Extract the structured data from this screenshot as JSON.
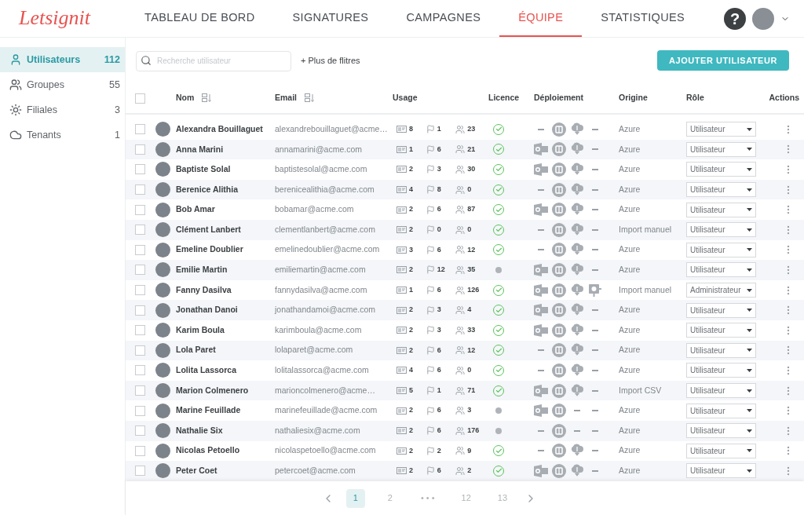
{
  "header": {
    "logo": "Letsignit",
    "nav": [
      {
        "label": "TABLEAU DE BORD",
        "selected": false
      },
      {
        "label": "SIGNATURES",
        "selected": false
      },
      {
        "label": "CAMPAGNES",
        "selected": false
      },
      {
        "label": "ÉQUIPE",
        "selected": true
      },
      {
        "label": "STATISTIQUES",
        "selected": false
      }
    ],
    "help": "?"
  },
  "sidebar": {
    "items": [
      {
        "kind": "user",
        "label": "Utilisateurs",
        "count": "112",
        "selected": true
      },
      {
        "kind": "groups",
        "label": "Groupes",
        "count": "55",
        "selected": false
      },
      {
        "kind": "branches",
        "label": "Filiales",
        "count": "3",
        "selected": false
      },
      {
        "kind": "tenants",
        "label": "Tenants",
        "count": "1",
        "selected": false
      }
    ]
  },
  "toolbar": {
    "search": {
      "placeholder": "Recherche utilisateur"
    },
    "filters": "+ Plus de flitres",
    "add_button": "AJOUTER UTILISATEUR"
  },
  "table": {
    "select_all": {
      "checked": false
    },
    "columns": [
      "Nom",
      "Email",
      "Usage",
      "Licence",
      "Déploiement",
      "Origine",
      "Rôle",
      "Actions"
    ],
    "rows": [
      {
        "name": "Alexandra Bouillaguet",
        "email": "alexandrebouillaguet@acme…",
        "usage": [
          "8",
          "1",
          "23"
        ],
        "licensed": true,
        "outlook": false,
        "office": true,
        "cloud": true,
        "addin": false,
        "origin": "Azure",
        "role": "Utilisateur",
        "checked": false
      },
      {
        "name": "Anna Marini",
        "email": "annamarini@acme.com",
        "usage": [
          "1",
          "6",
          "21"
        ],
        "licensed": true,
        "outlook": true,
        "office": true,
        "cloud": true,
        "addin": false,
        "origin": "Azure",
        "role": "Utilisateur",
        "checked": false
      },
      {
        "name": "Baptiste Solal",
        "email": "baptistesolal@acme.com",
        "usage": [
          "2",
          "3",
          "30"
        ],
        "licensed": true,
        "outlook": true,
        "office": true,
        "cloud": true,
        "addin": false,
        "origin": "Azure",
        "role": "Utilisateur",
        "checked": false
      },
      {
        "name": "Berenice Alithia",
        "email": "berenicealithia@acme.com",
        "usage": [
          "4",
          "8",
          "0"
        ],
        "licensed": true,
        "outlook": false,
        "office": true,
        "cloud": true,
        "addin": false,
        "origin": "Azure",
        "role": "Utilisateur",
        "checked": false
      },
      {
        "name": "Bob Amar",
        "email": "bobamar@acme.com",
        "usage": [
          "2",
          "6",
          "87"
        ],
        "licensed": true,
        "outlook": true,
        "office": true,
        "cloud": true,
        "addin": false,
        "origin": "Azure",
        "role": "Utilisateur",
        "checked": false
      },
      {
        "name": "Clément Lanbert",
        "email": "clementlanbert@acme.com",
        "usage": [
          "2",
          "0",
          "0"
        ],
        "licensed": true,
        "outlook": false,
        "office": true,
        "cloud": true,
        "addin": false,
        "origin": "Import manuel",
        "role": "Utilisateur",
        "checked": false
      },
      {
        "name": "Emeline Doublier",
        "email": "emelinedoublier@acme.com",
        "usage": [
          "3",
          "6",
          "12"
        ],
        "licensed": true,
        "outlook": false,
        "office": true,
        "cloud": true,
        "addin": false,
        "origin": "Azure",
        "role": "Utilisateur",
        "checked": false
      },
      {
        "name": "Emilie Martin",
        "email": "emiliemartin@acme.com",
        "usage": [
          "2",
          "12",
          "35"
        ],
        "licensed": false,
        "outlook": true,
        "office": true,
        "cloud": true,
        "addin": false,
        "origin": "Azure",
        "role": "Utilisateur",
        "checked": false
      },
      {
        "name": "Fanny Dasilva",
        "email": "fannydasilva@acme.com",
        "usage": [
          "1",
          "6",
          "126"
        ],
        "licensed": true,
        "outlook": true,
        "office": true,
        "cloud": true,
        "addin": true,
        "origin": "Import manuel",
        "role": "Administrateur",
        "checked": false
      },
      {
        "name": "Jonathan Danoi",
        "email": "jonathandamoi@acme.com",
        "usage": [
          "2",
          "3",
          "4"
        ],
        "licensed": true,
        "outlook": true,
        "office": true,
        "cloud": true,
        "addin": false,
        "origin": "Azure",
        "role": "Utilisateur",
        "checked": false
      },
      {
        "name": "Karim Boula",
        "email": "karimboula@acme.com",
        "usage": [
          "2",
          "3",
          "33"
        ],
        "licensed": true,
        "outlook": true,
        "office": true,
        "cloud": true,
        "addin": false,
        "origin": "Azure",
        "role": "Utilisateur",
        "checked": false
      },
      {
        "name": "Lola Paret",
        "email": "lolaparet@acme.com",
        "usage": [
          "2",
          "6",
          "12"
        ],
        "licensed": true,
        "outlook": false,
        "office": true,
        "cloud": true,
        "addin": false,
        "origin": "Azure",
        "role": "Utilisateur",
        "checked": false
      },
      {
        "name": "Lolita Lassorca",
        "email": "lolitalassorca@acme.com",
        "usage": [
          "4",
          "6",
          "0"
        ],
        "licensed": true,
        "outlook": false,
        "office": true,
        "cloud": true,
        "addin": false,
        "origin": "Azure",
        "role": "Utilisateur",
        "checked": false
      },
      {
        "name": "Marion Colmenero",
        "email": "marioncolmenero@acme…",
        "usage": [
          "5",
          "1",
          "71"
        ],
        "licensed": true,
        "outlook": true,
        "office": true,
        "cloud": true,
        "addin": false,
        "origin": "Import CSV",
        "role": "Utilisateur",
        "checked": false
      },
      {
        "name": "Marine Feuillade",
        "email": "marinefeuillade@acme.com",
        "usage": [
          "2",
          "6",
          "3"
        ],
        "licensed": false,
        "outlook": true,
        "office": true,
        "cloud": false,
        "addin": false,
        "origin": "Azure",
        "role": "Utilisateur",
        "checked": false
      },
      {
        "name": "Nathalie Six",
        "email": "nathaliesix@acme.com",
        "usage": [
          "2",
          "6",
          "176"
        ],
        "licensed": false,
        "outlook": false,
        "office": true,
        "cloud": false,
        "addin": false,
        "origin": "Azure",
        "role": "Utilisateur",
        "checked": false
      },
      {
        "name": "Nicolas Petoello",
        "email": "nicolaspetoello@acme.com",
        "usage": [
          "2",
          "2",
          "9"
        ],
        "licensed": true,
        "outlook": false,
        "office": true,
        "cloud": true,
        "addin": false,
        "origin": "Azure",
        "role": "Utilisateur",
        "checked": false
      },
      {
        "name": "Peter Coet",
        "email": "petercoet@acme.com",
        "usage": [
          "2",
          "6",
          "2"
        ],
        "licensed": true,
        "outlook": true,
        "office": true,
        "cloud": true,
        "addin": false,
        "origin": "Azure",
        "role": "Utilisateur",
        "checked": false
      }
    ]
  },
  "pagination": {
    "pages": [
      {
        "label": "1",
        "selected": true
      },
      {
        "label": "2",
        "selected": false
      },
      {
        "label": "• • •",
        "selected": false
      },
      {
        "label": "12",
        "selected": false
      },
      {
        "label": "13",
        "selected": false
      }
    ]
  }
}
